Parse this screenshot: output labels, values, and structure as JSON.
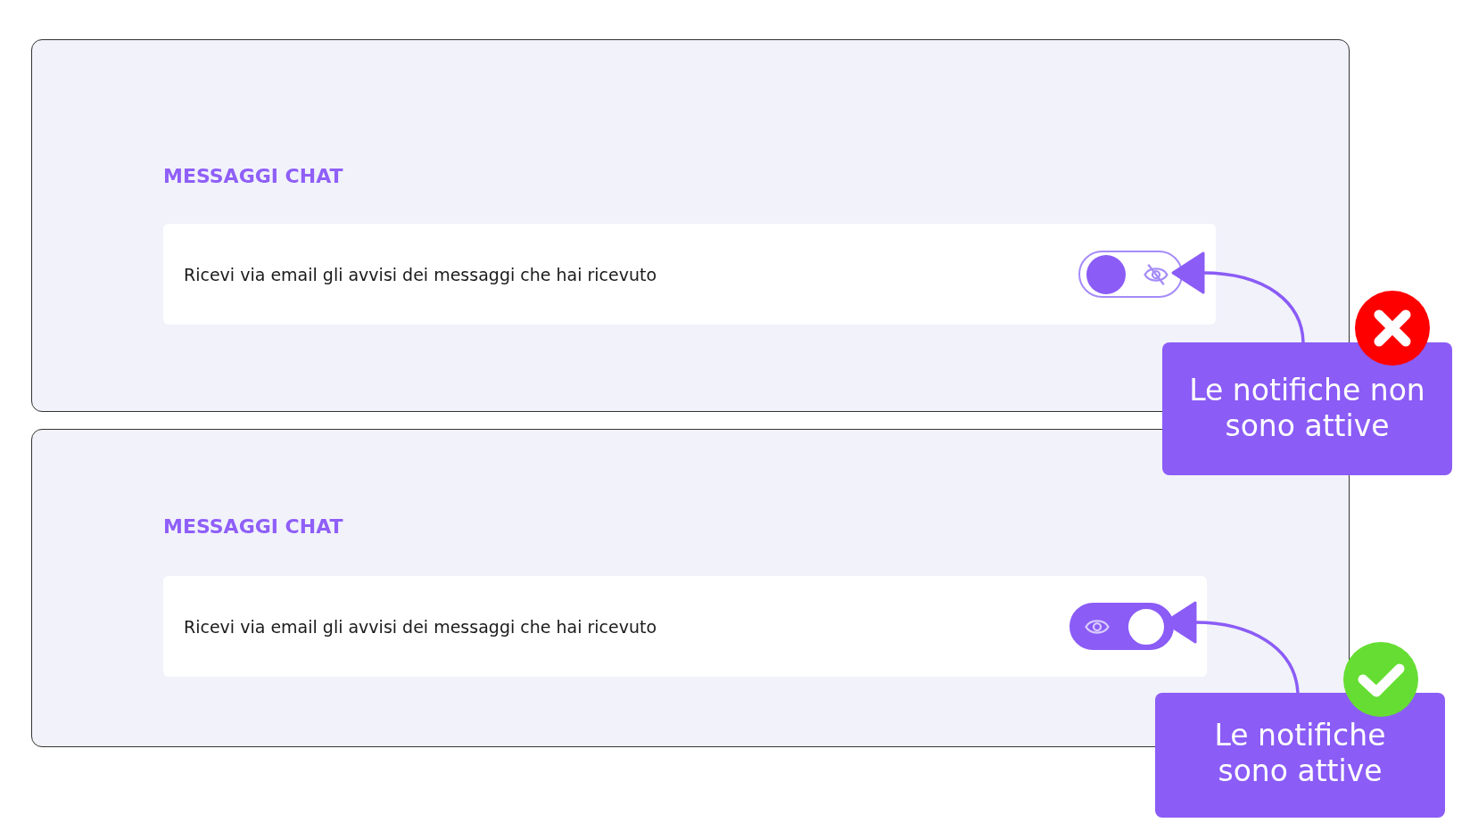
{
  "sections": [
    {
      "heading": "MESSAGGI CHAT",
      "label": "Ricevi via email gli avvisi dei messaggi che hai ricevuto",
      "toggle": {
        "on": false
      },
      "callout": {
        "text": "Le notifiche non sono attive",
        "kind": "error"
      }
    },
    {
      "heading": "MESSAGGI CHAT",
      "label": "Ricevi via email gli avvisi dei messaggi che hai ricevuto",
      "toggle": {
        "on": true
      },
      "callout": {
        "text": "Le notifiche sono attive",
        "kind": "success"
      }
    }
  ]
}
